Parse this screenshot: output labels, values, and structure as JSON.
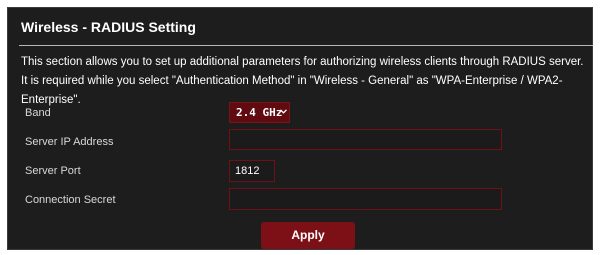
{
  "page": {
    "title": "Wireless - RADIUS Setting",
    "description": "This section allows you to set up additional parameters for authorizing wireless clients through RADIUS server. It is required while you select \"Authentication Method\" in \"Wireless - General\" as \"WPA-Enterprise / WPA2-Enterprise\"."
  },
  "form": {
    "band": {
      "label": "Band",
      "selected": "2.4 GHz"
    },
    "server_ip": {
      "label": "Server IP Address",
      "value": ""
    },
    "server_port": {
      "label": "Server Port",
      "value": "1812"
    },
    "connection_secret": {
      "label": "Connection Secret",
      "value": ""
    }
  },
  "actions": {
    "apply_label": "Apply"
  },
  "colors": {
    "panel_bg": "#1d1d1d",
    "accent": "#7d1016",
    "field_border": "#6e1016",
    "text": "#ffffff"
  },
  "icons": {
    "band_dropdown": "chevron-down-icon"
  }
}
